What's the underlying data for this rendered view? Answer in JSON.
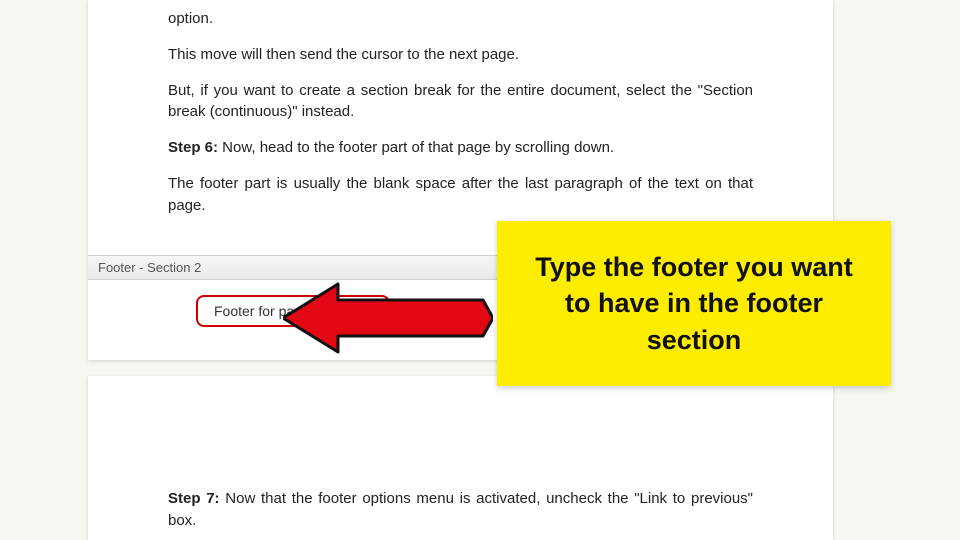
{
  "article": {
    "paragraphs": {
      "p1_tail": "option.",
      "p2": "This move will then send the cursor to the next page.",
      "p3": "But, if you want to create a section break for the entire document, select the \"Section break (continuous)\" instead.",
      "step6_label": "Step 6:",
      "step6_text": " Now, head to the footer part of that page by scrolling down.",
      "p5": "The footer part is usually the blank space after the last paragraph of the text on that page.",
      "step7_label": "Step 7:",
      "step7_text": " Now that the footer options menu is activated, uncheck the \"Link to previous\" box."
    }
  },
  "footer": {
    "section_label": "Footer - Section 2",
    "input_value": "Footer for page 2 sample"
  },
  "callout": {
    "text": "Type the footer you want to have in the footer section"
  },
  "colors": {
    "highlight_box": "#cc0000",
    "callout_bg": "#ffed00",
    "arrow": "#e30613"
  }
}
